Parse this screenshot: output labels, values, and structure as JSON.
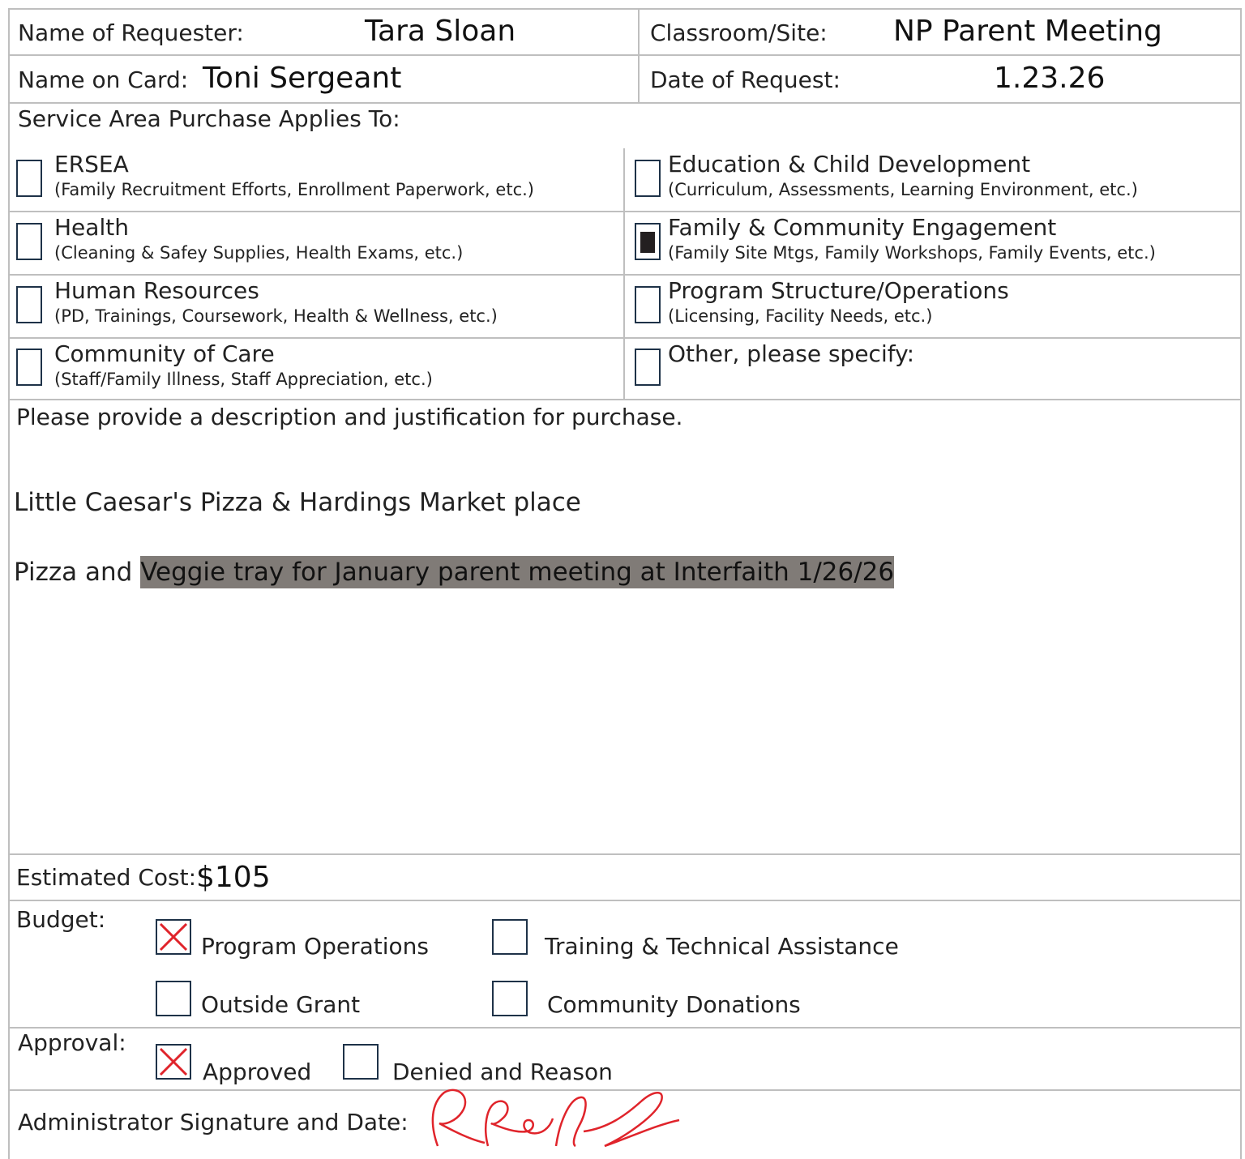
{
  "header": {
    "requester_label": "Name of Requester:",
    "requester_value": "Tara Sloan",
    "site_label": "Classroom/Site:",
    "site_value": "NP Parent Meeting",
    "card_label": "Name on Card:",
    "card_value": "Toni Sergeant",
    "date_label": "Date of Request:",
    "date_value": "1.23.26"
  },
  "service_area": {
    "heading": "Service Area Purchase Applies To:",
    "items": [
      {
        "title": "ERSEA",
        "detail": "(Family Recruitment Efforts, Enrollment Paperwork, etc.)",
        "checked": false
      },
      {
        "title": "Education & Child Development",
        "detail": "(Curriculum, Assessments, Learning Environment, etc.)",
        "checked": false
      },
      {
        "title": "Health",
        "detail": "(Cleaning & Safey Supplies, Health Exams, etc.)",
        "checked": false
      },
      {
        "title": "Family & Community Engagement",
        "detail": "(Family Site Mtgs, Family Workshops, Family Events, etc.)",
        "checked": true
      },
      {
        "title": "Human Resources",
        "detail": "(PD, Trainings, Coursework, Health & Wellness, etc.)",
        "checked": false
      },
      {
        "title": "Program Structure/Operations",
        "detail": "(Licensing, Facility Needs, etc.)",
        "checked": false
      },
      {
        "title": "Community of Care",
        "detail": "(Staff/Family Illness, Staff Appreciation, etc.)",
        "checked": false
      },
      {
        "title": "Other, please specify:",
        "detail": "",
        "checked": false
      }
    ]
  },
  "description": {
    "prompt": "Please provide a description and justification for purchase.",
    "line1": "Little Caesar's Pizza & Hardings Market place",
    "line2_plain": "Pizza and ",
    "line2_highlight": "Veggie tray for January parent meeting at Interfaith 1/26/26"
  },
  "cost": {
    "label": "Estimated Cost:",
    "value": "$105"
  },
  "budget": {
    "label": "Budget:",
    "options": [
      {
        "label": "Program Operations",
        "checked": true
      },
      {
        "label": "Training & Technical Assistance",
        "checked": false
      },
      {
        "label": "Outside Grant",
        "checked": false
      },
      {
        "label": "Community Donations",
        "checked": false
      }
    ]
  },
  "approval": {
    "label": "Approval:",
    "approved_label": "Approved",
    "approved_checked": true,
    "denied_label": "Denied and Reason",
    "denied_checked": false
  },
  "signature": {
    "label": "Administrator Signature and Date:"
  },
  "colors": {
    "checkbox_border": "#1e3248",
    "x_mark": "#e0242b",
    "signature_ink": "#e0242b",
    "highlight": "#807b77"
  }
}
